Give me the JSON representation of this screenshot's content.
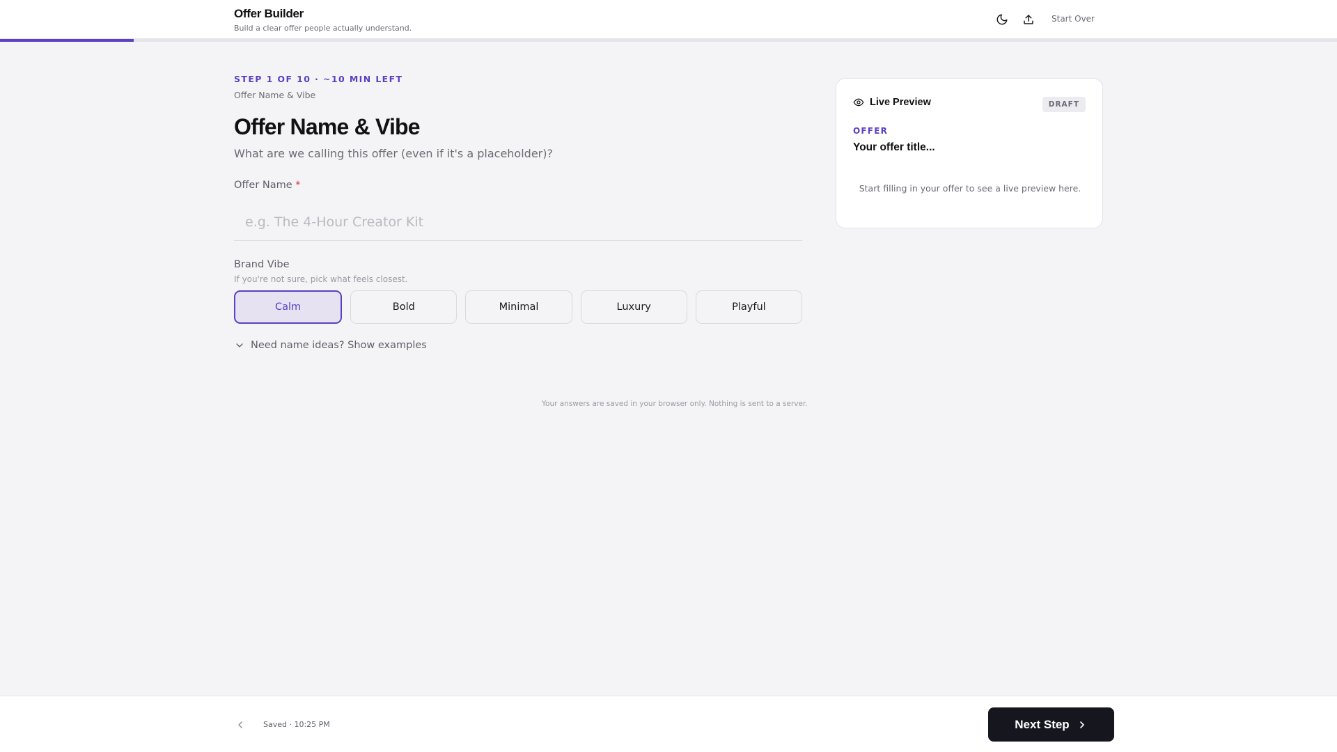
{
  "header": {
    "title": "Offer Builder",
    "subtitle": "Build a clear offer people actually understand.",
    "theme_icon": "moon-icon",
    "export_icon": "upload-icon",
    "start_over_label": "Start Over"
  },
  "progress": {
    "current_step": 1,
    "total_steps": 10,
    "fraction": 0.1
  },
  "step": {
    "label": "STEP 1 OF 10 · ~10 MIN LEFT",
    "name": "Offer Name & Vibe",
    "title": "Offer Name & Vibe",
    "question": "What are we calling this offer (even if it's a placeholder)?"
  },
  "offer_name": {
    "label": "Offer Name",
    "required_mark": "*",
    "value": "",
    "placeholder": "e.g. The 4-Hour Creator Kit"
  },
  "brand_vibe": {
    "label": "Brand Vibe",
    "hint": "If you're not sure, pick what feels closest.",
    "options": [
      "Calm",
      "Bold",
      "Minimal",
      "Luxury",
      "Playful"
    ],
    "selected": "Calm"
  },
  "examples_toggle": {
    "label": "Need name ideas? Show examples",
    "icon": "chevron-down-icon"
  },
  "privacy_note": "Your answers are saved in your browser only. Nothing is sent to a server.",
  "preview": {
    "icon": "eye-icon",
    "title": "Live Preview",
    "badge": "DRAFT",
    "section_label": "OFFER",
    "offer_title": "Your offer title...",
    "empty_message": "Start filling in your offer to see a live preview here."
  },
  "footer": {
    "back_icon": "chevron-left-icon",
    "saved_text": "Saved · 10:25 PM",
    "next_label": "Next Step",
    "next_icon": "chevron-right-icon"
  },
  "colors": {
    "accent": "#5b3fc4",
    "background": "#f4f4f6",
    "primary_button": "#16161f",
    "required": "#d93535"
  }
}
